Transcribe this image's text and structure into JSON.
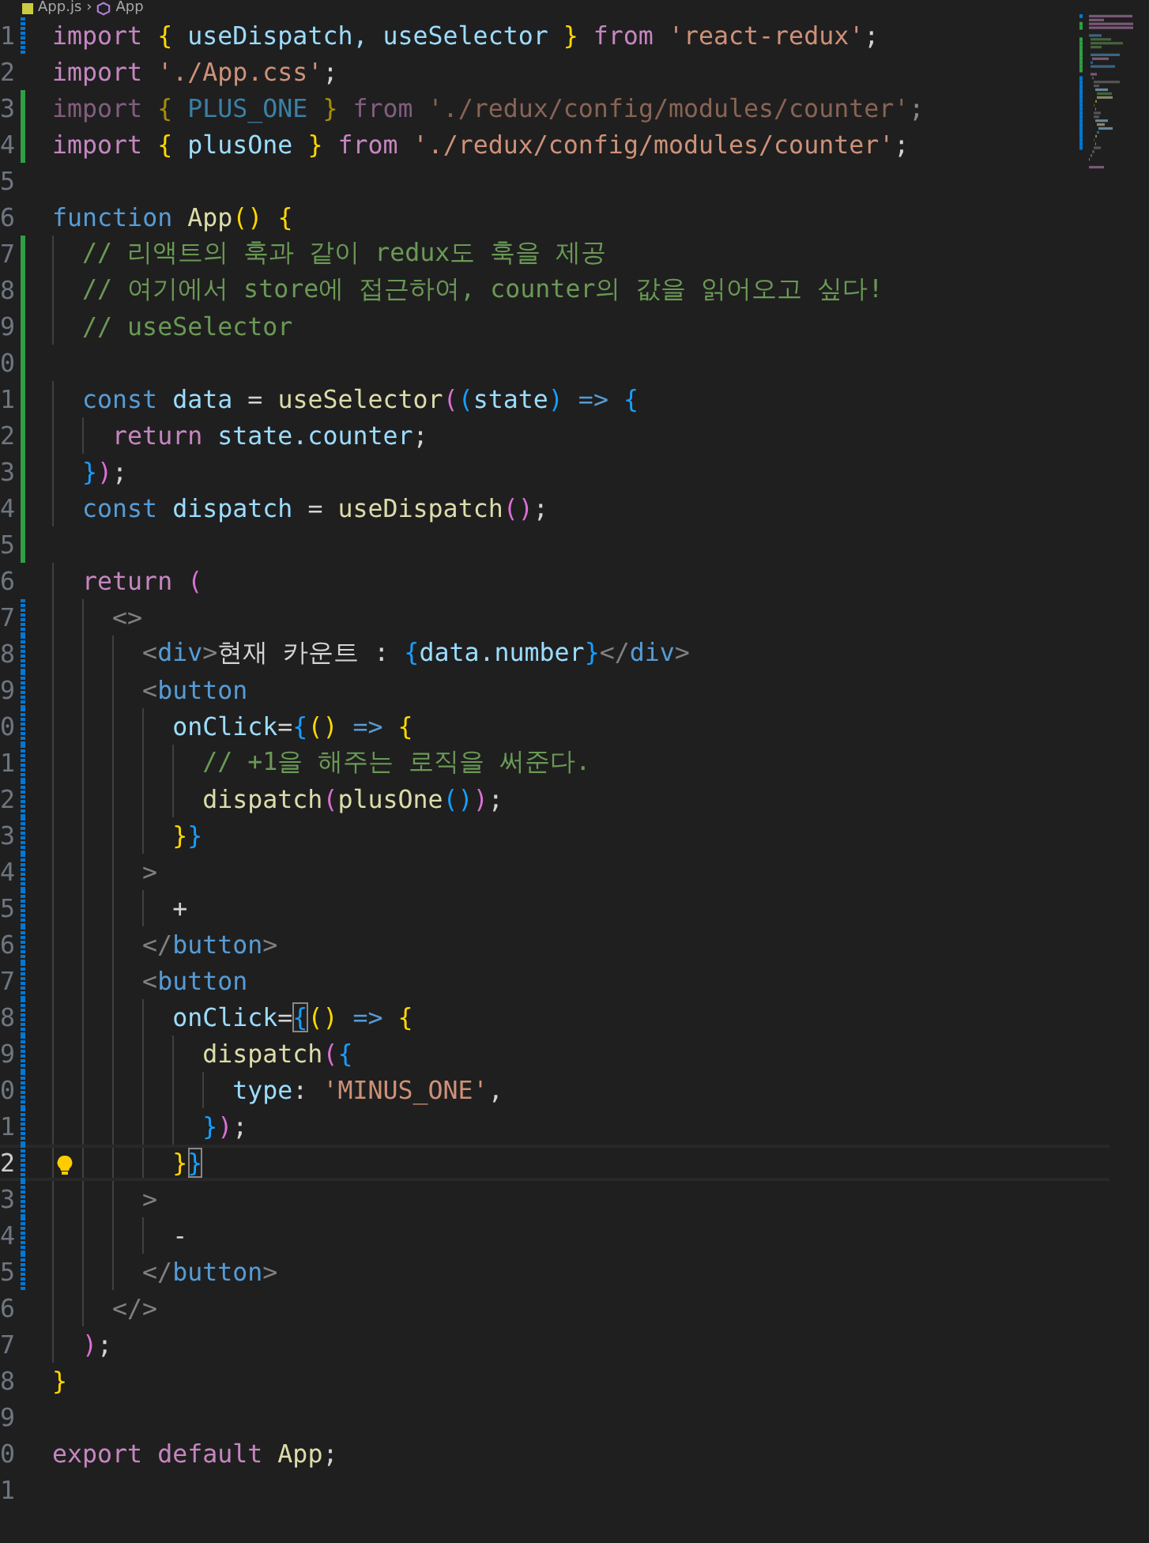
{
  "breadcrumb": {
    "separator": "›",
    "items": [
      {
        "label": "App.js",
        "kind": "file"
      },
      {
        "label": "App",
        "kind": "symbol"
      }
    ]
  },
  "lines": [
    {
      "number": "1",
      "added": false,
      "modified": true,
      "tokens": [
        {
          "kind": "keyword",
          "text": "import "
        },
        {
          "kind": "bracket1",
          "text": "{"
        },
        {
          "kind": "variable",
          "text": " useDispatch, useSelector "
        },
        {
          "kind": "bracket1",
          "text": "}"
        },
        {
          "kind": "keyword",
          "text": " from "
        },
        {
          "kind": "string",
          "text": "'react-redux'"
        },
        {
          "kind": "plain",
          "text": ";"
        }
      ]
    },
    {
      "number": "2",
      "added": false,
      "modified": false,
      "tokens": [
        {
          "kind": "keyword",
          "text": "import "
        },
        {
          "kind": "string",
          "text": "'./App.css'"
        },
        {
          "kind": "plain",
          "text": ";"
        }
      ]
    },
    {
      "number": "3",
      "added": true,
      "modified": false,
      "faded": true,
      "tokens": [
        {
          "kind": "keyword",
          "text": "import "
        },
        {
          "kind": "bracket1",
          "text": "{"
        },
        {
          "kind": "constant",
          "text": " PLUS_ONE "
        },
        {
          "kind": "bracket1",
          "text": "}"
        },
        {
          "kind": "keyword",
          "text": " from "
        },
        {
          "kind": "string",
          "text": "'./redux/config/modules/counter'"
        },
        {
          "kind": "plain",
          "text": ";"
        }
      ]
    },
    {
      "number": "4",
      "added": true,
      "modified": false,
      "tokens": [
        {
          "kind": "keyword",
          "text": "import "
        },
        {
          "kind": "bracket1",
          "text": "{"
        },
        {
          "kind": "variable",
          "text": " plusOne "
        },
        {
          "kind": "bracket1",
          "text": "}"
        },
        {
          "kind": "keyword",
          "text": " from "
        },
        {
          "kind": "string",
          "text": "'./redux/config/modules/counter'"
        },
        {
          "kind": "plain",
          "text": ";"
        }
      ]
    },
    {
      "number": "5",
      "added": false,
      "modified": false
    },
    {
      "number": "6",
      "added": false,
      "modified": false,
      "tokens": [
        {
          "kind": "storage",
          "text": "function "
        },
        {
          "kind": "function",
          "text": "App"
        },
        {
          "kind": "bracket1",
          "text": "()"
        },
        {
          "kind": "bracket1",
          "text": " {"
        }
      ]
    },
    {
      "number": "7",
      "added": true,
      "modified": false,
      "tokens": [
        {
          "kind": "comment",
          "text": "  // 리액트의 훅과 같이 redux도 훅을 제공"
        }
      ]
    },
    {
      "number": "8",
      "added": true,
      "modified": false,
      "tokens": [
        {
          "kind": "comment",
          "text": "  // 여기에서 store에 접근하여, counter의 값을 읽어오고 싶다!"
        }
      ]
    },
    {
      "number": "9",
      "added": true,
      "modified": false,
      "tokens": [
        {
          "kind": "comment",
          "text": "  // useSelector"
        }
      ]
    },
    {
      "number": "0",
      "added": true,
      "modified": false
    },
    {
      "number": "1",
      "added": true,
      "modified": false,
      "tokens": [
        {
          "kind": "storage",
          "text": "  const"
        },
        {
          "kind": "variable",
          "text": " data"
        },
        {
          "kind": "plain",
          "text": " = "
        },
        {
          "kind": "function",
          "text": "useSelector"
        },
        {
          "kind": "bracket2",
          "text": "("
        },
        {
          "kind": "bracket3",
          "text": "("
        },
        {
          "kind": "variable",
          "text": "state"
        },
        {
          "kind": "bracket3",
          "text": ")"
        },
        {
          "kind": "storage",
          "text": " => "
        },
        {
          "kind": "bracket3",
          "text": "{"
        }
      ]
    },
    {
      "number": "2",
      "added": true,
      "modified": false,
      "tokens": [
        {
          "kind": "keyword",
          "text": "    return"
        },
        {
          "kind": "variable",
          "text": " state.counter"
        },
        {
          "kind": "plain",
          "text": ";"
        }
      ]
    },
    {
      "number": "3",
      "added": true,
      "modified": false,
      "tokens": [
        {
          "kind": "bracket3",
          "text": "  }"
        },
        {
          "kind": "bracket2",
          "text": ")"
        },
        {
          "kind": "plain",
          "text": ";"
        }
      ]
    },
    {
      "number": "4",
      "added": true,
      "modified": false,
      "tokens": [
        {
          "kind": "storage",
          "text": "  const"
        },
        {
          "kind": "variable",
          "text": " dispatch"
        },
        {
          "kind": "plain",
          "text": " = "
        },
        {
          "kind": "function",
          "text": "useDispatch"
        },
        {
          "kind": "bracket2",
          "text": "()"
        },
        {
          "kind": "plain",
          "text": ";"
        }
      ]
    },
    {
      "number": "5",
      "added": true,
      "modified": false
    },
    {
      "number": "6",
      "added": false,
      "modified": false,
      "tokens": [
        {
          "kind": "keyword",
          "text": "  return"
        },
        {
          "kind": "bracket2",
          "text": " ("
        }
      ]
    },
    {
      "number": "7",
      "added": false,
      "modified": true,
      "tokens": [
        {
          "kind": "tag",
          "text": "    <>"
        }
      ]
    },
    {
      "number": "8",
      "added": false,
      "modified": true,
      "tokens": [
        {
          "kind": "tag",
          "text": "      <"
        },
        {
          "kind": "tagname",
          "text": "div"
        },
        {
          "kind": "tag",
          "text": ">"
        },
        {
          "kind": "plain",
          "text": "현재 카운트 : "
        },
        {
          "kind": "bracket3",
          "text": "{"
        },
        {
          "kind": "variable",
          "text": "data.number"
        },
        {
          "kind": "bracket3",
          "text": "}"
        },
        {
          "kind": "tag",
          "text": "</"
        },
        {
          "kind": "tagname",
          "text": "div"
        },
        {
          "kind": "tag",
          "text": ">"
        }
      ]
    },
    {
      "number": "9",
      "added": false,
      "modified": true,
      "tokens": [
        {
          "kind": "tag",
          "text": "      <"
        },
        {
          "kind": "tagname",
          "text": "button"
        }
      ]
    },
    {
      "number": "0",
      "added": false,
      "modified": true,
      "tokens": [
        {
          "kind": "variable",
          "text": "        onClick"
        },
        {
          "kind": "plain",
          "text": "="
        },
        {
          "kind": "bracket3",
          "text": "{"
        },
        {
          "kind": "bracket1",
          "text": "()"
        },
        {
          "kind": "storage",
          "text": " => "
        },
        {
          "kind": "bracket1",
          "text": "{"
        }
      ]
    },
    {
      "number": "1",
      "added": false,
      "modified": true,
      "tokens": [
        {
          "kind": "comment",
          "text": "          // +1을 해주는 로직을 써준다."
        }
      ]
    },
    {
      "number": "2",
      "added": false,
      "modified": true,
      "tokens": [
        {
          "kind": "function",
          "text": "          dispatch"
        },
        {
          "kind": "bracket2",
          "text": "("
        },
        {
          "kind": "function",
          "text": "plusOne"
        },
        {
          "kind": "bracket3",
          "text": "()"
        },
        {
          "kind": "bracket2",
          "text": ")"
        },
        {
          "kind": "plain",
          "text": ";"
        }
      ]
    },
    {
      "number": "3",
      "added": false,
      "modified": true,
      "tokens": [
        {
          "kind": "bracket1",
          "text": "        }"
        },
        {
          "kind": "bracket3",
          "text": "}"
        }
      ]
    },
    {
      "number": "4",
      "added": false,
      "modified": true,
      "tokens": [
        {
          "kind": "tag",
          "text": "      >"
        }
      ]
    },
    {
      "number": "5",
      "added": false,
      "modified": true,
      "tokens": [
        {
          "kind": "plain",
          "text": "        +"
        }
      ]
    },
    {
      "number": "6",
      "added": false,
      "modified": true,
      "tokens": [
        {
          "kind": "tag",
          "text": "      </"
        },
        {
          "kind": "tagname",
          "text": "button"
        },
        {
          "kind": "tag",
          "text": ">"
        }
      ]
    },
    {
      "number": "7",
      "added": false,
      "modified": true,
      "tokens": [
        {
          "kind": "tag",
          "text": "      <"
        },
        {
          "kind": "tagname",
          "text": "button"
        }
      ]
    },
    {
      "number": "8",
      "added": false,
      "modified": true,
      "tokens": [
        {
          "kind": "variable",
          "text": "        onClick"
        },
        {
          "kind": "plain",
          "text": "="
        },
        {
          "kind": "bracket3",
          "text": "{",
          "matched": true
        },
        {
          "kind": "bracket1",
          "text": "()"
        },
        {
          "kind": "storage",
          "text": " => "
        },
        {
          "kind": "bracket1",
          "text": "{"
        }
      ]
    },
    {
      "number": "9",
      "added": false,
      "modified": true,
      "tokens": [
        {
          "kind": "function",
          "text": "          dispatch"
        },
        {
          "kind": "bracket2",
          "text": "("
        },
        {
          "kind": "bracket3",
          "text": "{"
        }
      ]
    },
    {
      "number": "0",
      "added": false,
      "modified": true,
      "tokens": [
        {
          "kind": "variable",
          "text": "            type"
        },
        {
          "kind": "plain",
          "text": ": "
        },
        {
          "kind": "string",
          "text": "'MINUS_ONE'"
        },
        {
          "kind": "plain",
          "text": ","
        }
      ]
    },
    {
      "number": "1",
      "added": false,
      "modified": true,
      "tokens": [
        {
          "kind": "bracket3",
          "text": "          }"
        },
        {
          "kind": "bracket2",
          "text": ")"
        },
        {
          "kind": "plain",
          "text": ";"
        }
      ]
    },
    {
      "number": "2",
      "added": false,
      "modified": true,
      "current": true,
      "lightbulb": true,
      "tokens": [
        {
          "kind": "bracket1",
          "text": "        }"
        },
        {
          "kind": "bracket3",
          "text": "}",
          "matched": true
        }
      ]
    },
    {
      "number": "3",
      "added": false,
      "modified": true,
      "tokens": [
        {
          "kind": "tag",
          "text": "      >"
        }
      ]
    },
    {
      "number": "4",
      "added": false,
      "modified": true,
      "tokens": [
        {
          "kind": "plain",
          "text": "        -"
        }
      ]
    },
    {
      "number": "5",
      "added": false,
      "modified": true,
      "tokens": [
        {
          "kind": "tag",
          "text": "      </"
        },
        {
          "kind": "tagname",
          "text": "button"
        },
        {
          "kind": "tag",
          "text": ">"
        }
      ]
    },
    {
      "number": "6",
      "added": false,
      "modified": false,
      "tokens": [
        {
          "kind": "tag",
          "text": "    </>"
        }
      ]
    },
    {
      "number": "7",
      "added": false,
      "modified": false,
      "tokens": [
        {
          "kind": "bracket2",
          "text": "  )"
        },
        {
          "kind": "plain",
          "text": ";"
        }
      ]
    },
    {
      "number": "8",
      "added": false,
      "modified": false,
      "tokens": [
        {
          "kind": "bracket1",
          "text": "}"
        }
      ]
    },
    {
      "number": "9",
      "added": false,
      "modified": false
    },
    {
      "number": "0",
      "added": false,
      "modified": false,
      "tokens": [
        {
          "kind": "keyword",
          "text": "export default "
        },
        {
          "kind": "function",
          "text": "App"
        },
        {
          "kind": "plain",
          "text": ";"
        }
      ]
    },
    {
      "number": "1",
      "added": false,
      "modified": false
    }
  ]
}
